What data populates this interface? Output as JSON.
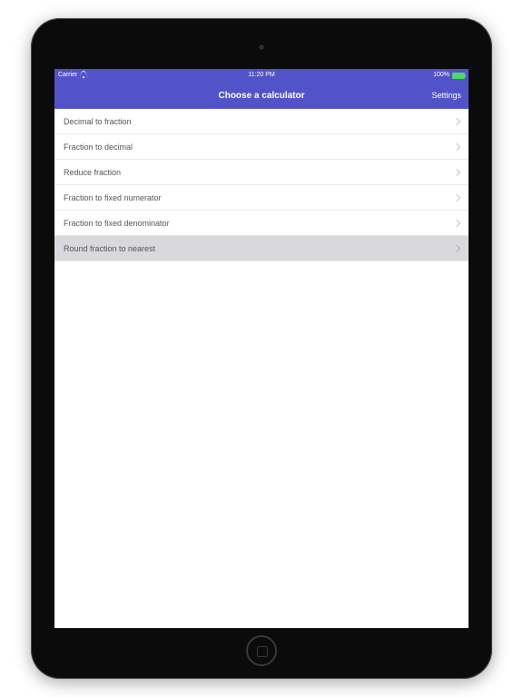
{
  "statusbar": {
    "carrier": "Carrier",
    "time": "11:20 PM",
    "battery_pct": "100%"
  },
  "navbar": {
    "title": "Choose a calculator",
    "settings_label": "Settings"
  },
  "calculators": [
    {
      "label": "Decimal to fraction",
      "highlighted": false
    },
    {
      "label": "Fraction to decimal",
      "highlighted": false
    },
    {
      "label": "Reduce fraction",
      "highlighted": false
    },
    {
      "label": "Fraction to fixed numerator",
      "highlighted": false
    },
    {
      "label": "Fraction to fixed denominator",
      "highlighted": false
    },
    {
      "label": "Round fraction to nearest",
      "highlighted": true
    }
  ]
}
